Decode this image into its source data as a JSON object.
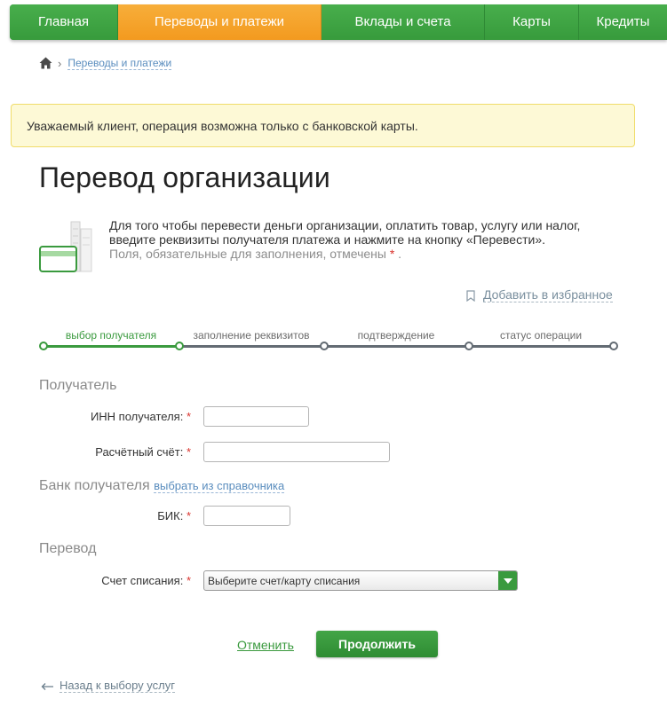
{
  "nav": {
    "items": [
      {
        "label": "Главная",
        "active": false
      },
      {
        "label": "Переводы и платежи",
        "active": true
      },
      {
        "label": "Вклады и счета",
        "active": false
      },
      {
        "label": "Карты",
        "active": false
      },
      {
        "label": "Кредиты",
        "active": false
      }
    ]
  },
  "breadcrumb": {
    "home_icon": "home-icon",
    "items": [
      "Переводы и платежи"
    ]
  },
  "alert": {
    "text": "Уважаемый клиент, операция возможна только с банковской карты."
  },
  "page": {
    "title": "Перевод организации"
  },
  "info": {
    "illustration": "card-and-buildings-illustration",
    "line1": "Для того чтобы перевести деньги организации, оплатить товар, услугу или налог,",
    "line2": "введите реквизиты получателя платежа и нажмите на кнопку «Перевести».",
    "note": "Поля, обязательные для заполнения, отмечены",
    "note_mark": "*",
    "note_end": "."
  },
  "favorites": {
    "icon": "bookmark-icon",
    "label": "Добавить в избранное"
  },
  "stepper": {
    "steps": [
      {
        "label": "выбор получателя",
        "active": true
      },
      {
        "label": "заполнение реквизитов",
        "active": false
      },
      {
        "label": "подтверждение",
        "active": false
      },
      {
        "label": "статус операции",
        "active": false
      }
    ]
  },
  "form": {
    "required_mark": "*",
    "recipient": {
      "title": "Получатель",
      "inn_label": "ИНН получателя:",
      "inn_value": "",
      "account_label": "Расчётный счёт:",
      "account_value": ""
    },
    "bank": {
      "title": "Банк получателя",
      "lookup_link": "выбрать из справочника",
      "bik_label": "БИК:",
      "bik_value": ""
    },
    "transfer": {
      "title": "Перевод",
      "debit_label": "Счет списания:",
      "debit_selected": "Выберите счет/карту списания"
    }
  },
  "actions": {
    "cancel": "Отменить",
    "continue": "Продолжить",
    "back": "Назад к выбору услуг",
    "back_icon": "arrow-left-icon"
  },
  "colors": {
    "brand_green": "#3fa244",
    "active_orange": "#f39a1f",
    "alert_bg": "#fdf9d6",
    "required_red": "#d9322c",
    "link_blue": "#5a8dbe"
  }
}
